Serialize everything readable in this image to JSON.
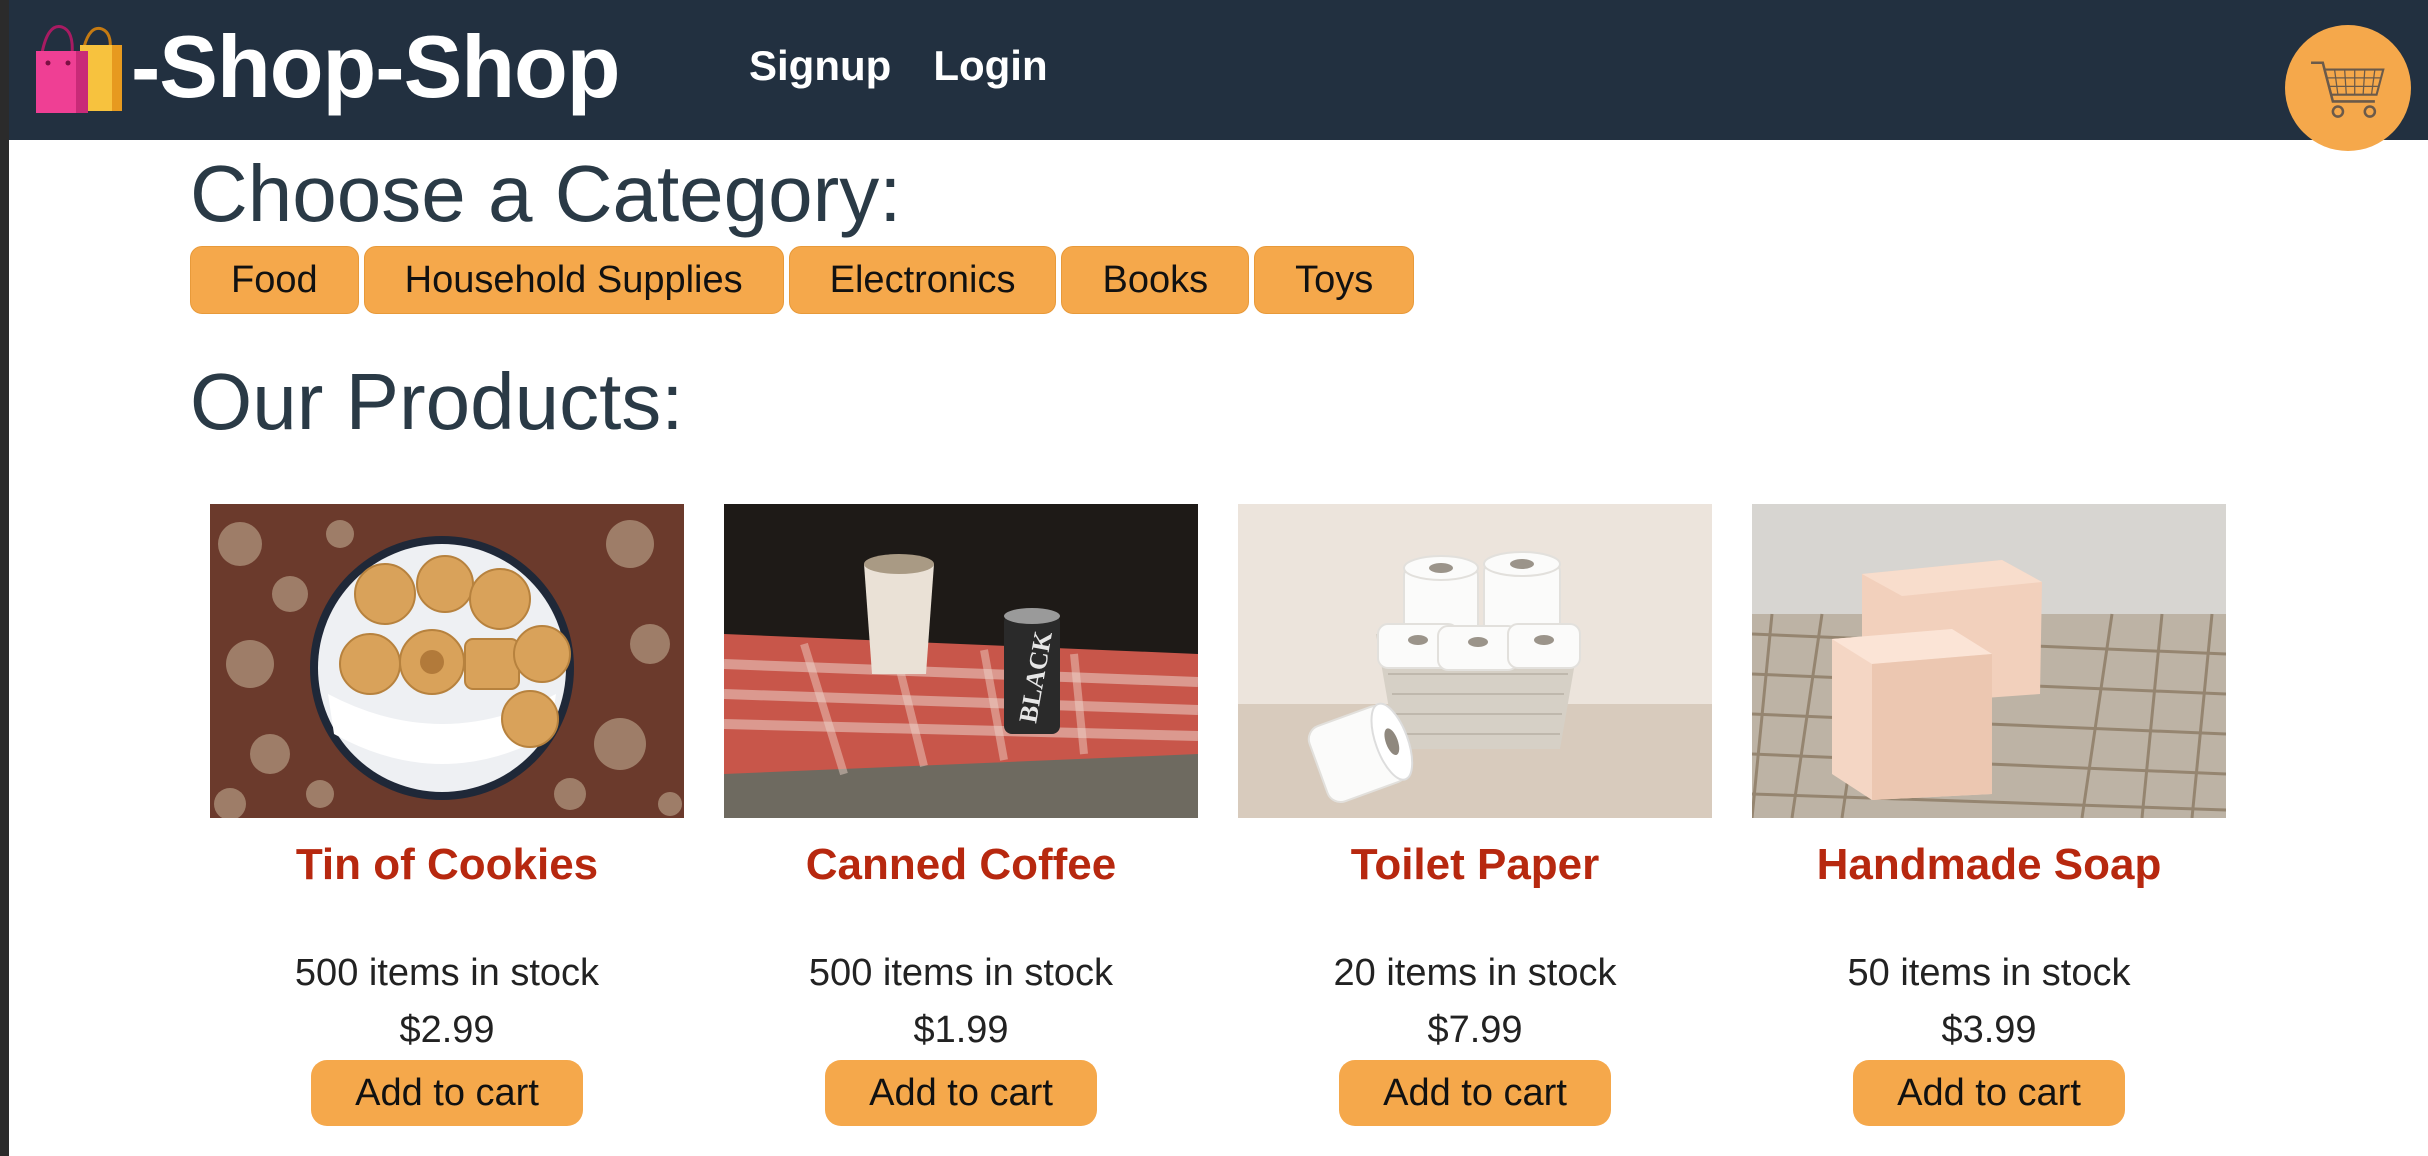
{
  "header": {
    "brand": "-Shop-Shop",
    "nav": [
      {
        "label": "Signup"
      },
      {
        "label": "Login"
      }
    ]
  },
  "categories": {
    "title": "Choose a Category:",
    "items": [
      {
        "label": "Food"
      },
      {
        "label": "Household Supplies"
      },
      {
        "label": "Electronics"
      },
      {
        "label": "Books"
      },
      {
        "label": "Toys"
      }
    ]
  },
  "products": {
    "title": "Our Products:",
    "items": [
      {
        "name": "Tin of Cookies",
        "stock": "500 items in stock",
        "price": "$2.99",
        "button": "Add to cart",
        "image": "cookies-photo"
      },
      {
        "name": "Canned Coffee",
        "stock": "500 items in stock",
        "price": "$1.99",
        "button": "Add to cart",
        "image": "coffee-photo",
        "can_text": "BLACK"
      },
      {
        "name": "Toilet Paper",
        "stock": "20 items in stock",
        "price": "$7.99",
        "button": "Add to cart",
        "image": "toilet-paper-photo"
      },
      {
        "name": "Handmade Soap",
        "stock": "50 items in stock",
        "price": "$3.99",
        "button": "Add to cart",
        "image": "soap-photo"
      }
    ]
  },
  "colors": {
    "header_bg": "#223040",
    "accent": "#f5a84b",
    "product_name": "#b7280f",
    "heading": "#2a3a46"
  },
  "icons": {
    "logo": "shopping-bags-icon",
    "cart": "shopping-cart-icon"
  }
}
